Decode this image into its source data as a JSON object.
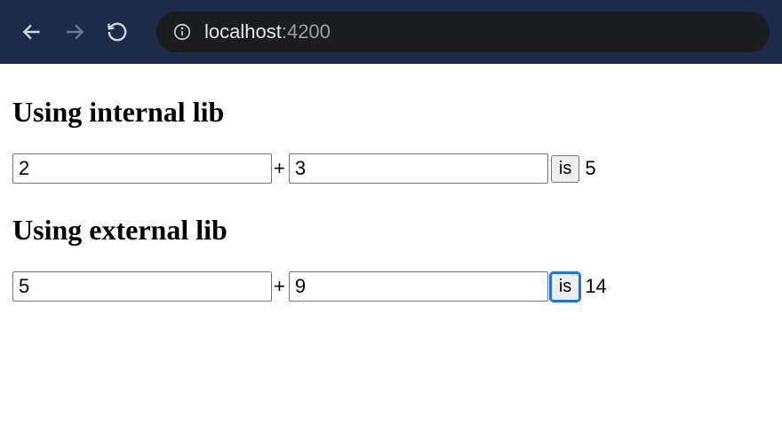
{
  "browser": {
    "url_host": "localhost",
    "url_port": ":4200"
  },
  "sections": {
    "internal": {
      "title": "Using internal lib",
      "a": "2",
      "plus": "+",
      "b": "3",
      "is_label": "is",
      "result": "5"
    },
    "external": {
      "title": "Using external lib",
      "a": "5",
      "plus": "+",
      "b": "9",
      "is_label": "is",
      "result": "14"
    }
  }
}
